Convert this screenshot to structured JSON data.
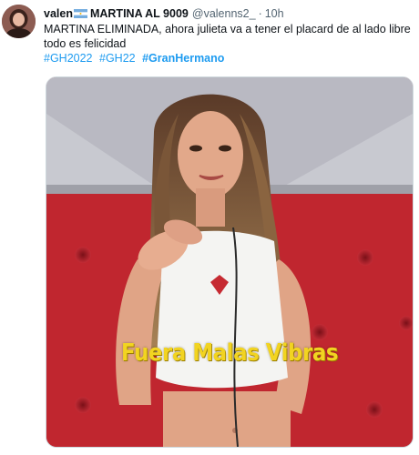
{
  "tweet": {
    "display_name": "valen",
    "display_name_suffix": "MARTINA AL 9009",
    "handle": "@valenns2_",
    "separator": "·",
    "time": "10h",
    "text": "MARTINA ELIMINADA, ahora julieta va a tener el placard de al lado libre todo es felicidad",
    "hashtags": [
      "#GH2022",
      "#GH22",
      "#GranHermano"
    ],
    "flag_icon": "argentina-flag-icon",
    "colors": {
      "link": "#1d9bf0",
      "text": "#0f1419",
      "secondary": "#536471"
    }
  },
  "media": {
    "caption": "Fuera Malas Vibras",
    "caption_color": "#f2d421"
  }
}
